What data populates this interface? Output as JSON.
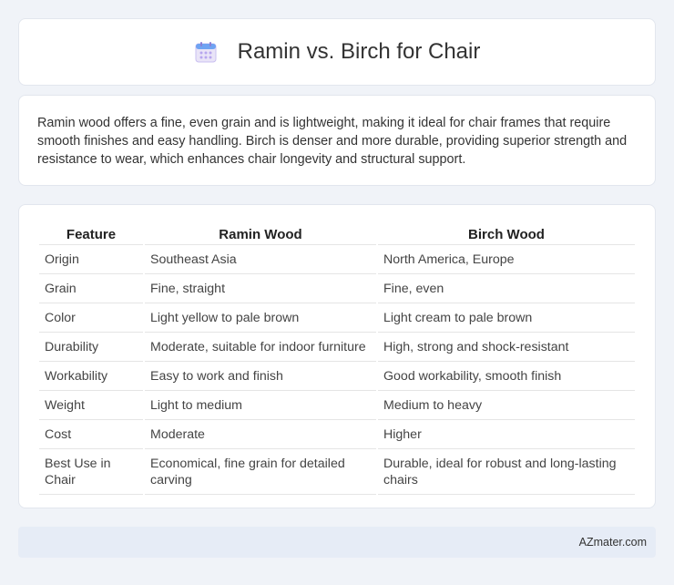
{
  "header": {
    "title": "Ramin vs. Birch for Chair",
    "icon": "calendar-icon"
  },
  "description": "Ramin wood offers a fine, even grain and is lightweight, making it ideal for chair frames that require smooth finishes and easy handling. Birch is denser and more durable, providing superior strength and resistance to wear, which enhances chair longevity and structural support.",
  "table": {
    "headers": [
      "Feature",
      "Ramin Wood",
      "Birch Wood"
    ],
    "rows": [
      [
        "Origin",
        "Southeast Asia",
        "North America, Europe"
      ],
      [
        "Grain",
        "Fine, straight",
        "Fine, even"
      ],
      [
        "Color",
        "Light yellow to pale brown",
        "Light cream to pale brown"
      ],
      [
        "Durability",
        "Moderate, suitable for indoor furniture",
        "High, strong and shock-resistant"
      ],
      [
        "Workability",
        "Easy to work and finish",
        "Good workability, smooth finish"
      ],
      [
        "Weight",
        "Light to medium",
        "Medium to heavy"
      ],
      [
        "Cost",
        "Moderate",
        "Higher"
      ],
      [
        "Best Use in Chair",
        "Economical, fine grain for detailed carving",
        "Durable, ideal for robust and long-lasting chairs"
      ]
    ]
  },
  "footer": {
    "brand": "AZmater.com"
  }
}
